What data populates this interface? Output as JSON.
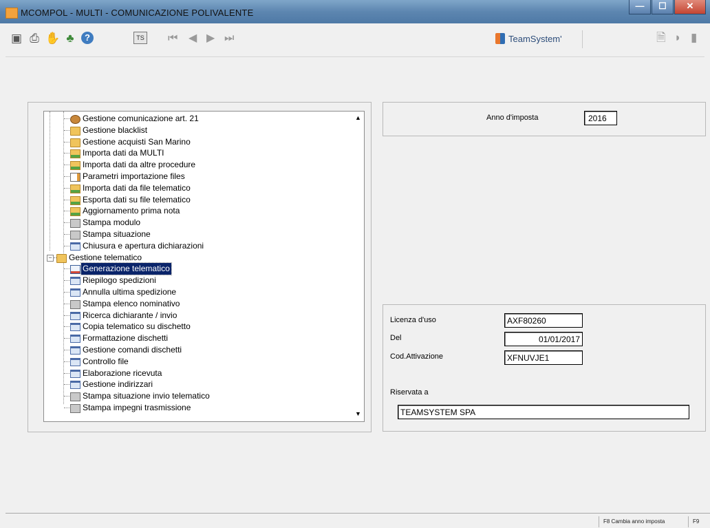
{
  "window": {
    "title": "MCOMPOL - MULTI - COMUNICAZIONE POLIVALENTE",
    "controls": [
      "minimize-icon",
      "maximize-icon",
      "close-icon"
    ],
    "min_glyph": "—",
    "max_glyph": "☐",
    "close_glyph": "✕"
  },
  "toolbar": {
    "icons": [
      "screen-icon",
      "printer-icon",
      "hand-icon",
      "tree-icon",
      "help-icon"
    ],
    "icon_glyphs": [
      "▣",
      "⎙",
      "✋",
      "♣",
      "?"
    ],
    "ts_label": "TS",
    "nav_first": "⏮",
    "nav_prev": "◀",
    "nav_next": "▶",
    "nav_last": "⏭",
    "brand": "TeamSystem'",
    "right_glyphs": [
      "🗎",
      "◗",
      "▮"
    ]
  },
  "tree": {
    "items": [
      {
        "label": "Gestione comunicazione art. 21",
        "icon": "people-icon",
        "level": 2
      },
      {
        "label": "Gestione blacklist",
        "icon": "folder-icon",
        "level": 2
      },
      {
        "label": "Gestione acquisti San Marino",
        "icon": "folder-icon",
        "level": 2
      },
      {
        "label": "Importa dati da MULTI",
        "icon": "import-icon",
        "level": 2
      },
      {
        "label": "Importa dati da altre procedure",
        "icon": "import-icon",
        "level": 2
      },
      {
        "label": "Parametri importazione files",
        "icon": "edit-icon",
        "level": 2
      },
      {
        "label": "Importa dati da file telematico",
        "icon": "import-icon",
        "level": 2
      },
      {
        "label": "Esporta dati su file telematico",
        "icon": "import-icon",
        "level": 2
      },
      {
        "label": "Aggiornamento prima nota",
        "icon": "import-icon",
        "level": 2
      },
      {
        "label": "Stampa modulo",
        "icon": "print-icon",
        "level": 2
      },
      {
        "label": "Stampa situazione",
        "icon": "print-icon",
        "level": 2
      },
      {
        "label": "Chiusura e apertura dichiarazioni",
        "icon": "panel-icon",
        "level": 2
      },
      {
        "label": "Gestione telematico",
        "icon": "folder-icon",
        "level": 1
      },
      {
        "label": "Generazione telematico",
        "icon": "gen-icon",
        "level": 2,
        "selected": true
      },
      {
        "label": "Riepilogo spedizioni",
        "icon": "panel-icon",
        "level": 2
      },
      {
        "label": "Annulla ultima spedizione",
        "icon": "panel-icon",
        "level": 2
      },
      {
        "label": "Stampa elenco nominativo",
        "icon": "print-icon",
        "level": 2
      },
      {
        "label": "Ricerca dichiarante / invio",
        "icon": "panel-icon",
        "level": 2
      },
      {
        "label": "Copia telematico su dischetto",
        "icon": "panel-icon",
        "level": 2
      },
      {
        "label": "Formattazione dischetti",
        "icon": "panel-icon",
        "level": 2
      },
      {
        "label": "Gestione comandi dischetti",
        "icon": "panel-icon",
        "level": 2
      },
      {
        "label": "Controllo file",
        "icon": "panel-icon",
        "level": 2
      },
      {
        "label": "Elaborazione ricevuta",
        "icon": "panel-icon",
        "level": 2
      },
      {
        "label": "Gestione indirizzari",
        "icon": "panel-icon",
        "level": 2
      },
      {
        "label": "Stampa situazione invio telematico",
        "icon": "print-icon",
        "level": 2
      },
      {
        "label": "Stampa impegni trasmissione",
        "icon": "print-icon",
        "level": 2
      }
    ],
    "collapse_glyph": "−",
    "scroll_up": "▲",
    "scroll_down": "▼"
  },
  "year_panel": {
    "label": "Anno d'imposta",
    "value": "2016"
  },
  "license": {
    "licenza_label": "Licenza d'uso",
    "licenza_value": "AXF80260",
    "del_label": "Del",
    "del_value": "01/01/2017",
    "cod_label": "Cod.Attivazione",
    "cod_value": "XFNUVJE1",
    "riservata_label": "Riservata a",
    "riservata_value": "TEAMSYSTEM SPA"
  },
  "statusbar": {
    "f8_label": "F8  Cambia anno imposta",
    "f9_label": "F9"
  }
}
